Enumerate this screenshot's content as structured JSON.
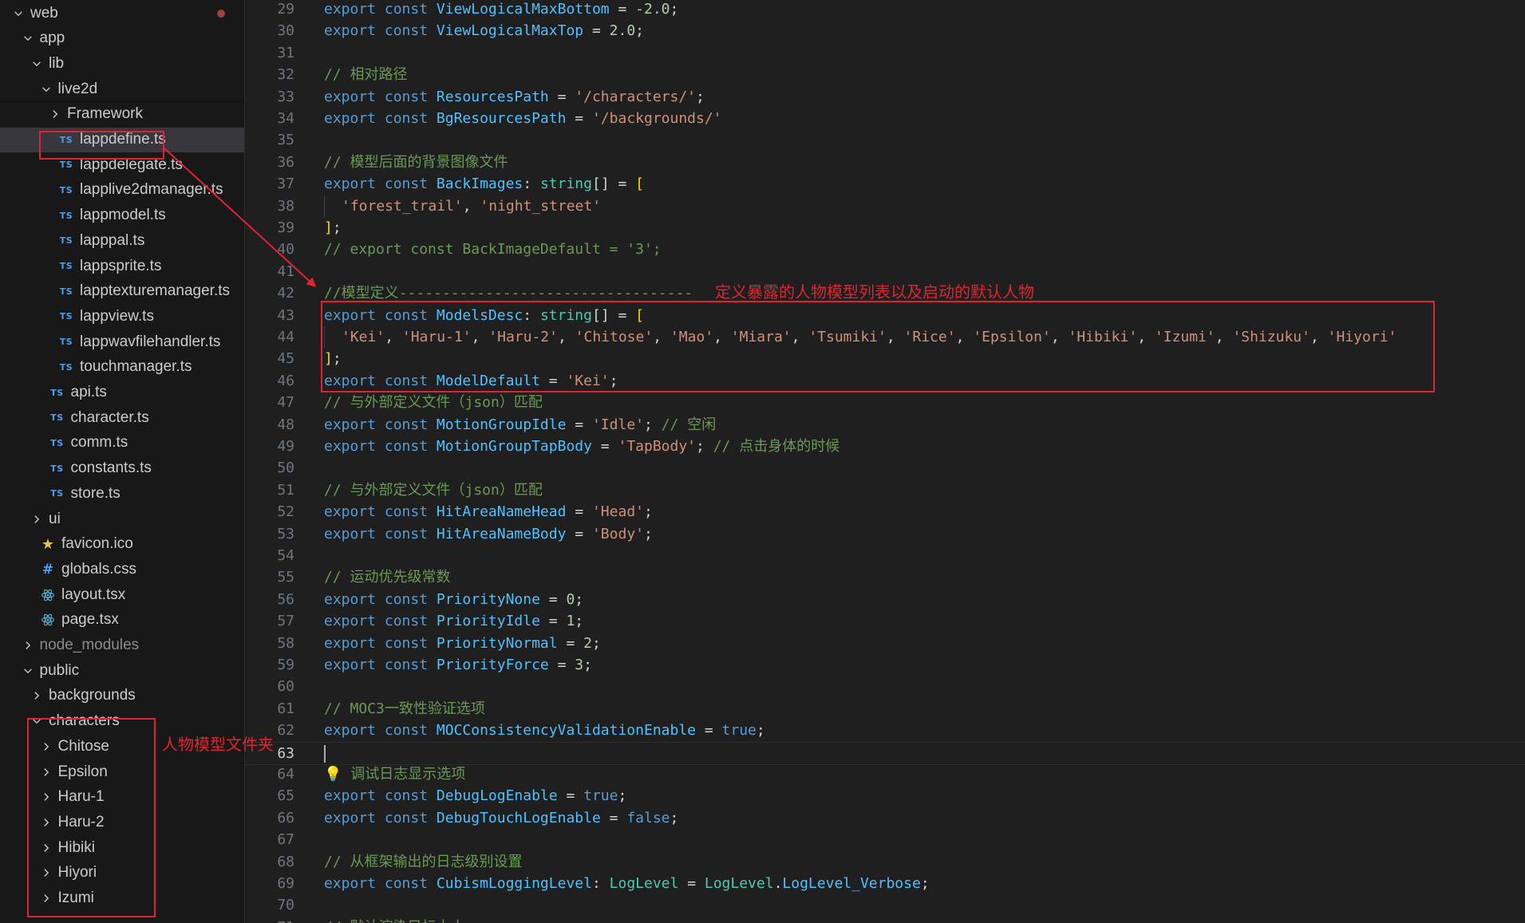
{
  "explorer": {
    "rows": [
      {
        "label": "web",
        "kind": "folder-open",
        "depth": 0,
        "modified": true
      },
      {
        "label": "app",
        "kind": "folder-open",
        "depth": 1
      },
      {
        "label": "lib",
        "kind": "folder-open",
        "depth": 2
      },
      {
        "label": "live2d",
        "kind": "folder-open",
        "depth": 3,
        "sticky": true
      },
      {
        "label": "Framework",
        "kind": "folder-closed",
        "depth": 4
      },
      {
        "label": "lappdefine.ts",
        "kind": "ts",
        "depth": 4,
        "selected": true
      },
      {
        "label": "lappdelegate.ts",
        "kind": "ts",
        "depth": 4
      },
      {
        "label": "lapplive2dmanager.ts",
        "kind": "ts",
        "depth": 4
      },
      {
        "label": "lappmodel.ts",
        "kind": "ts",
        "depth": 4
      },
      {
        "label": "lapppal.ts",
        "kind": "ts",
        "depth": 4
      },
      {
        "label": "lappsprite.ts",
        "kind": "ts",
        "depth": 4
      },
      {
        "label": "lapptexturemanager.ts",
        "kind": "ts",
        "depth": 4
      },
      {
        "label": "lappview.ts",
        "kind": "ts",
        "depth": 4
      },
      {
        "label": "lappwavfilehandler.ts",
        "kind": "ts",
        "depth": 4
      },
      {
        "label": "touchmanager.ts",
        "kind": "ts",
        "depth": 4
      },
      {
        "label": "api.ts",
        "kind": "ts",
        "depth": 3
      },
      {
        "label": "character.ts",
        "kind": "ts",
        "depth": 3
      },
      {
        "label": "comm.ts",
        "kind": "ts",
        "depth": 3
      },
      {
        "label": "constants.ts",
        "kind": "ts",
        "depth": 3
      },
      {
        "label": "store.ts",
        "kind": "ts",
        "depth": 3
      },
      {
        "label": "ui",
        "kind": "folder-closed",
        "depth": 2
      },
      {
        "label": "favicon.ico",
        "kind": "star",
        "depth": 2
      },
      {
        "label": "globals.css",
        "kind": "css",
        "depth": 2
      },
      {
        "label": "layout.tsx",
        "kind": "react",
        "depth": 2
      },
      {
        "label": "page.tsx",
        "kind": "react",
        "depth": 2
      },
      {
        "label": "node_modules",
        "kind": "folder-closed",
        "depth": 1,
        "dim": true
      },
      {
        "label": "public",
        "kind": "folder-open",
        "depth": 1
      },
      {
        "label": "backgrounds",
        "kind": "folder-closed",
        "depth": 2
      },
      {
        "label": "characters",
        "kind": "folder-open",
        "depth": 2
      },
      {
        "label": "Chitose",
        "kind": "folder-closed",
        "depth": 3
      },
      {
        "label": "Epsilon",
        "kind": "folder-closed",
        "depth": 3
      },
      {
        "label": "Haru-1",
        "kind": "folder-closed",
        "depth": 3
      },
      {
        "label": "Haru-2",
        "kind": "folder-closed",
        "depth": 3
      },
      {
        "label": "Hibiki",
        "kind": "folder-closed",
        "depth": 3
      },
      {
        "label": "Hiyori",
        "kind": "folder-closed",
        "depth": 3
      },
      {
        "label": "Izumi",
        "kind": "folder-closed",
        "depth": 3
      }
    ]
  },
  "editor": {
    "active_line": 63,
    "lines": [
      {
        "n": "29",
        "t": [
          [
            "kw",
            "export "
          ],
          [
            "kw",
            "const "
          ],
          [
            "id",
            "ViewLogicalMaxBottom"
          ],
          [
            "pun",
            " = "
          ],
          [
            "num",
            "-2.0"
          ],
          [
            "pun",
            ";"
          ]
        ]
      },
      {
        "n": "30",
        "t": [
          [
            "kw",
            "export "
          ],
          [
            "kw",
            "const "
          ],
          [
            "id",
            "ViewLogicalMaxTop"
          ],
          [
            "pun",
            " = "
          ],
          [
            "num",
            "2.0"
          ],
          [
            "pun",
            ";"
          ]
        ]
      },
      {
        "n": "31",
        "t": []
      },
      {
        "n": "32",
        "t": [
          [
            "cm",
            "// 相对路径"
          ]
        ]
      },
      {
        "n": "33",
        "t": [
          [
            "kw",
            "export "
          ],
          [
            "kw",
            "const "
          ],
          [
            "id",
            "ResourcesPath"
          ],
          [
            "pun",
            " = "
          ],
          [
            "str",
            "'/characters/'"
          ],
          [
            "pun",
            ";"
          ]
        ]
      },
      {
        "n": "34",
        "t": [
          [
            "kw",
            "export "
          ],
          [
            "kw",
            "const "
          ],
          [
            "id",
            "BgResourcesPath"
          ],
          [
            "pun",
            " = "
          ],
          [
            "str",
            "'/backgrounds/'"
          ]
        ]
      },
      {
        "n": "35",
        "t": []
      },
      {
        "n": "36",
        "t": [
          [
            "cm",
            "// 模型后面的背景图像文件"
          ]
        ]
      },
      {
        "n": "37",
        "t": [
          [
            "kw",
            "export "
          ],
          [
            "kw",
            "const "
          ],
          [
            "id",
            "BackImages"
          ],
          [
            "pun",
            ": "
          ],
          [
            "ty",
            "string"
          ],
          [
            "pun",
            "[] = "
          ],
          [
            "brk",
            "["
          ]
        ]
      },
      {
        "n": "38",
        "t": [
          [
            "guide",
            ""
          ],
          [
            "str",
            "'forest_trail'"
          ],
          [
            "pun",
            ", "
          ],
          [
            "str",
            "'night_street'"
          ]
        ]
      },
      {
        "n": "39",
        "t": [
          [
            "brk",
            "]"
          ],
          [
            "pun",
            ";"
          ]
        ]
      },
      {
        "n": "40",
        "t": [
          [
            "cm",
            "// export const BackImageDefault = '3';"
          ]
        ]
      },
      {
        "n": "41",
        "t": []
      },
      {
        "n": "42",
        "t": [
          [
            "cm",
            "//模型定义----------------------------------"
          ]
        ]
      },
      {
        "n": "43",
        "t": [
          [
            "kw",
            "export "
          ],
          [
            "kw",
            "const "
          ],
          [
            "id",
            "ModelsDesc"
          ],
          [
            "pun",
            ": "
          ],
          [
            "ty",
            "string"
          ],
          [
            "pun",
            "[] = "
          ],
          [
            "brk",
            "["
          ]
        ]
      },
      {
        "n": "44",
        "t": [
          [
            "guide",
            ""
          ],
          [
            "str",
            "'Kei'"
          ],
          [
            "pun",
            ", "
          ],
          [
            "str",
            "'Haru-1'"
          ],
          [
            "pun",
            ", "
          ],
          [
            "str",
            "'Haru-2'"
          ],
          [
            "pun",
            ", "
          ],
          [
            "str",
            "'Chitose'"
          ],
          [
            "pun",
            ", "
          ],
          [
            "str",
            "'Mao'"
          ],
          [
            "pun",
            ", "
          ],
          [
            "str",
            "'Miara'"
          ],
          [
            "pun",
            ", "
          ],
          [
            "str",
            "'Tsumiki'"
          ],
          [
            "pun",
            ", "
          ],
          [
            "str",
            "'Rice'"
          ],
          [
            "pun",
            ", "
          ],
          [
            "str",
            "'Epsilon'"
          ],
          [
            "pun",
            ", "
          ],
          [
            "str",
            "'Hibiki'"
          ],
          [
            "pun",
            ", "
          ],
          [
            "str",
            "'Izumi'"
          ],
          [
            "pun",
            ", "
          ],
          [
            "str",
            "'Shizuku'"
          ],
          [
            "pun",
            ", "
          ],
          [
            "str",
            "'Hiyori'"
          ]
        ]
      },
      {
        "n": "45",
        "t": [
          [
            "brk",
            "]"
          ],
          [
            "pun",
            ";"
          ]
        ]
      },
      {
        "n": "46",
        "t": [
          [
            "kw",
            "export "
          ],
          [
            "kw",
            "const "
          ],
          [
            "id",
            "ModelDefault"
          ],
          [
            "pun",
            " = "
          ],
          [
            "str",
            "'Kei'"
          ],
          [
            "pun",
            ";"
          ]
        ]
      },
      {
        "n": "47",
        "t": [
          [
            "cm",
            "// 与外部定义文件（json）匹配"
          ]
        ]
      },
      {
        "n": "48",
        "t": [
          [
            "kw",
            "export "
          ],
          [
            "kw",
            "const "
          ],
          [
            "id",
            "MotionGroupIdle"
          ],
          [
            "pun",
            " = "
          ],
          [
            "str",
            "'Idle'"
          ],
          [
            "pun",
            "; "
          ],
          [
            "cm",
            "// 空闲"
          ]
        ]
      },
      {
        "n": "49",
        "t": [
          [
            "kw",
            "export "
          ],
          [
            "kw",
            "const "
          ],
          [
            "id",
            "MotionGroupTapBody"
          ],
          [
            "pun",
            " = "
          ],
          [
            "str",
            "'TapBody'"
          ],
          [
            "pun",
            "; "
          ],
          [
            "cm",
            "// 点击身体的时候"
          ]
        ]
      },
      {
        "n": "50",
        "t": []
      },
      {
        "n": "51",
        "t": [
          [
            "cm",
            "// 与外部定义文件（json）匹配"
          ]
        ]
      },
      {
        "n": "52",
        "t": [
          [
            "kw",
            "export "
          ],
          [
            "kw",
            "const "
          ],
          [
            "id",
            "HitAreaNameHead"
          ],
          [
            "pun",
            " = "
          ],
          [
            "str",
            "'Head'"
          ],
          [
            "pun",
            ";"
          ]
        ]
      },
      {
        "n": "53",
        "t": [
          [
            "kw",
            "export "
          ],
          [
            "kw",
            "const "
          ],
          [
            "id",
            "HitAreaNameBody"
          ],
          [
            "pun",
            " = "
          ],
          [
            "str",
            "'Body'"
          ],
          [
            "pun",
            ";"
          ]
        ]
      },
      {
        "n": "54",
        "t": []
      },
      {
        "n": "55",
        "t": [
          [
            "cm",
            "// 运动优先级常数"
          ]
        ]
      },
      {
        "n": "56",
        "t": [
          [
            "kw",
            "export "
          ],
          [
            "kw",
            "const "
          ],
          [
            "id",
            "PriorityNone"
          ],
          [
            "pun",
            " = "
          ],
          [
            "num",
            "0"
          ],
          [
            "pun",
            ";"
          ]
        ]
      },
      {
        "n": "57",
        "t": [
          [
            "kw",
            "export "
          ],
          [
            "kw",
            "const "
          ],
          [
            "id",
            "PriorityIdle"
          ],
          [
            "pun",
            " = "
          ],
          [
            "num",
            "1"
          ],
          [
            "pun",
            ";"
          ]
        ]
      },
      {
        "n": "58",
        "t": [
          [
            "kw",
            "export "
          ],
          [
            "kw",
            "const "
          ],
          [
            "id",
            "PriorityNormal"
          ],
          [
            "pun",
            " = "
          ],
          [
            "num",
            "2"
          ],
          [
            "pun",
            ";"
          ]
        ]
      },
      {
        "n": "59",
        "t": [
          [
            "kw",
            "export "
          ],
          [
            "kw",
            "const "
          ],
          [
            "id",
            "PriorityForce"
          ],
          [
            "pun",
            " = "
          ],
          [
            "num",
            "3"
          ],
          [
            "pun",
            ";"
          ]
        ]
      },
      {
        "n": "60",
        "t": []
      },
      {
        "n": "61",
        "t": [
          [
            "cm",
            "// MOC3一致性验证选项"
          ]
        ]
      },
      {
        "n": "62",
        "t": [
          [
            "kw",
            "export "
          ],
          [
            "kw",
            "const "
          ],
          [
            "id",
            "MOCConsistencyValidationEnable"
          ],
          [
            "pun",
            " = "
          ],
          [
            "bool",
            "true"
          ],
          [
            "pun",
            ";"
          ]
        ]
      },
      {
        "n": "63",
        "t": []
      },
      {
        "n": "64",
        "t": [
          [
            "bulb",
            "💡"
          ],
          [
            "cm",
            " 调试日志显示选项"
          ]
        ]
      },
      {
        "n": "65",
        "t": [
          [
            "kw",
            "export "
          ],
          [
            "kw",
            "const "
          ],
          [
            "id",
            "DebugLogEnable"
          ],
          [
            "pun",
            " = "
          ],
          [
            "bool",
            "true"
          ],
          [
            "pun",
            ";"
          ]
        ]
      },
      {
        "n": "66",
        "t": [
          [
            "kw",
            "export "
          ],
          [
            "kw",
            "const "
          ],
          [
            "id",
            "DebugTouchLogEnable"
          ],
          [
            "pun",
            " = "
          ],
          [
            "bool",
            "false"
          ],
          [
            "pun",
            ";"
          ]
        ]
      },
      {
        "n": "67",
        "t": []
      },
      {
        "n": "68",
        "t": [
          [
            "cm",
            "// 从框架输出的日志级别设置"
          ]
        ]
      },
      {
        "n": "69",
        "t": [
          [
            "kw",
            "export "
          ],
          [
            "kw",
            "const "
          ],
          [
            "id",
            "CubismLoggingLevel"
          ],
          [
            "pun",
            ": "
          ],
          [
            "ty",
            "LogLevel"
          ],
          [
            "pun",
            " = "
          ],
          [
            "ty",
            "LogLevel"
          ],
          [
            "pun",
            "."
          ],
          [
            "id",
            "LogLevel_Verbose"
          ],
          [
            "pun",
            ";"
          ]
        ]
      },
      {
        "n": "70",
        "t": []
      },
      {
        "n": "71",
        "t": [
          [
            "cm",
            "// 默认渲染目标大小"
          ]
        ]
      }
    ]
  },
  "annotations": {
    "models_note": "定义暴露的人物模型列表以及启动的默认人物",
    "characters_note": "人物模型文件夹"
  },
  "colors": {
    "annotation": "#e0242f",
    "selection": "#37373d"
  }
}
